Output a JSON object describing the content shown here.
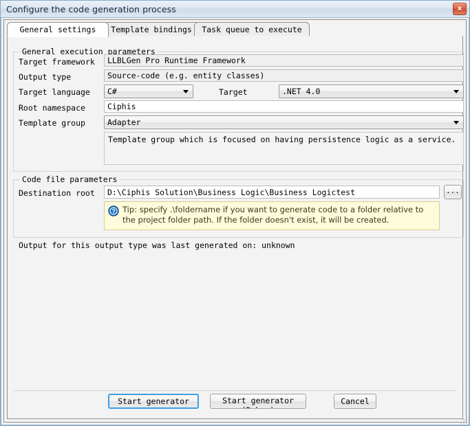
{
  "window": {
    "title": "Configure the code generation process",
    "close_label": "x"
  },
  "tabs": [
    {
      "label": "General settings",
      "active": true
    },
    {
      "label": "Template bindings",
      "active": false
    },
    {
      "label": "Task queue to execute",
      "active": false
    }
  ],
  "groups": {
    "general": {
      "title": "General execution parameters",
      "fields": {
        "target_framework": {
          "label": "Target framework",
          "value": "LLBLGen Pro Runtime Framework"
        },
        "output_type": {
          "label": "Output type",
          "value": "Source-code (e.g. entity classes)"
        },
        "target_language": {
          "label": "Target language",
          "value": "C#"
        },
        "target": {
          "label": "Target",
          "value": ".NET 4.0"
        },
        "root_namespace": {
          "label": "Root namespace",
          "value": "Ciphis"
        },
        "template_group": {
          "label": "Template group",
          "value": "Adapter"
        },
        "template_group_description": "Template group which is focused on having persistence logic as a service."
      }
    },
    "code_file": {
      "title": "Code file parameters",
      "fields": {
        "destination_root": {
          "label": "Destination root",
          "value": "D:\\Ciphis Solution\\Business Logic\\Business Logictest"
        },
        "browse_label": "..."
      },
      "tip": {
        "icon": "info-circle-icon",
        "text": "Tip: specify .\\foldername if you want to generate code to a folder relative to the project folder path. If the folder doesn't exist, it will be created."
      }
    }
  },
  "status": {
    "text": "Output for this output type was last generated on: unknown"
  },
  "footer": {
    "start_normal": "Start generator\n(Normal)",
    "start_debug": "Start generator\n(Debug)",
    "cancel": "Cancel"
  },
  "colors": {
    "accent": "#3c9fe0",
    "close_button": "#d2492f",
    "tip_background": "#fdfbdc",
    "tip_border": "#d9cf8a"
  }
}
